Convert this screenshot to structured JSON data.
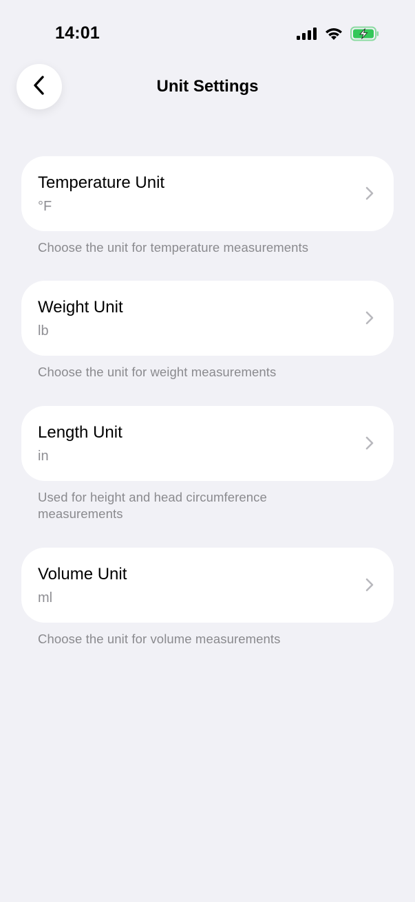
{
  "status_bar": {
    "time": "14:01",
    "icons": [
      "cellular-signal-icon",
      "wifi-icon",
      "battery-charging-icon"
    ],
    "battery_color": "#34C759"
  },
  "header": {
    "title": "Unit Settings",
    "back_icon": "chevron-left-icon"
  },
  "settings": [
    {
      "title": "Temperature Unit",
      "value": "°F",
      "caption": "Choose the unit for temperature measurements"
    },
    {
      "title": "Weight Unit",
      "value": "lb",
      "caption": "Choose the unit for weight measurements"
    },
    {
      "title": "Length Unit",
      "value": "in",
      "caption": "Used for height and head circumference measurements"
    },
    {
      "title": "Volume Unit",
      "value": "ml",
      "caption": "Choose the unit for volume measurements"
    }
  ],
  "colors": {
    "background": "#F1F1F6",
    "card": "#FFFFFF",
    "secondary_text": "#8E8E93",
    "chevron": "#B8B8BD"
  }
}
